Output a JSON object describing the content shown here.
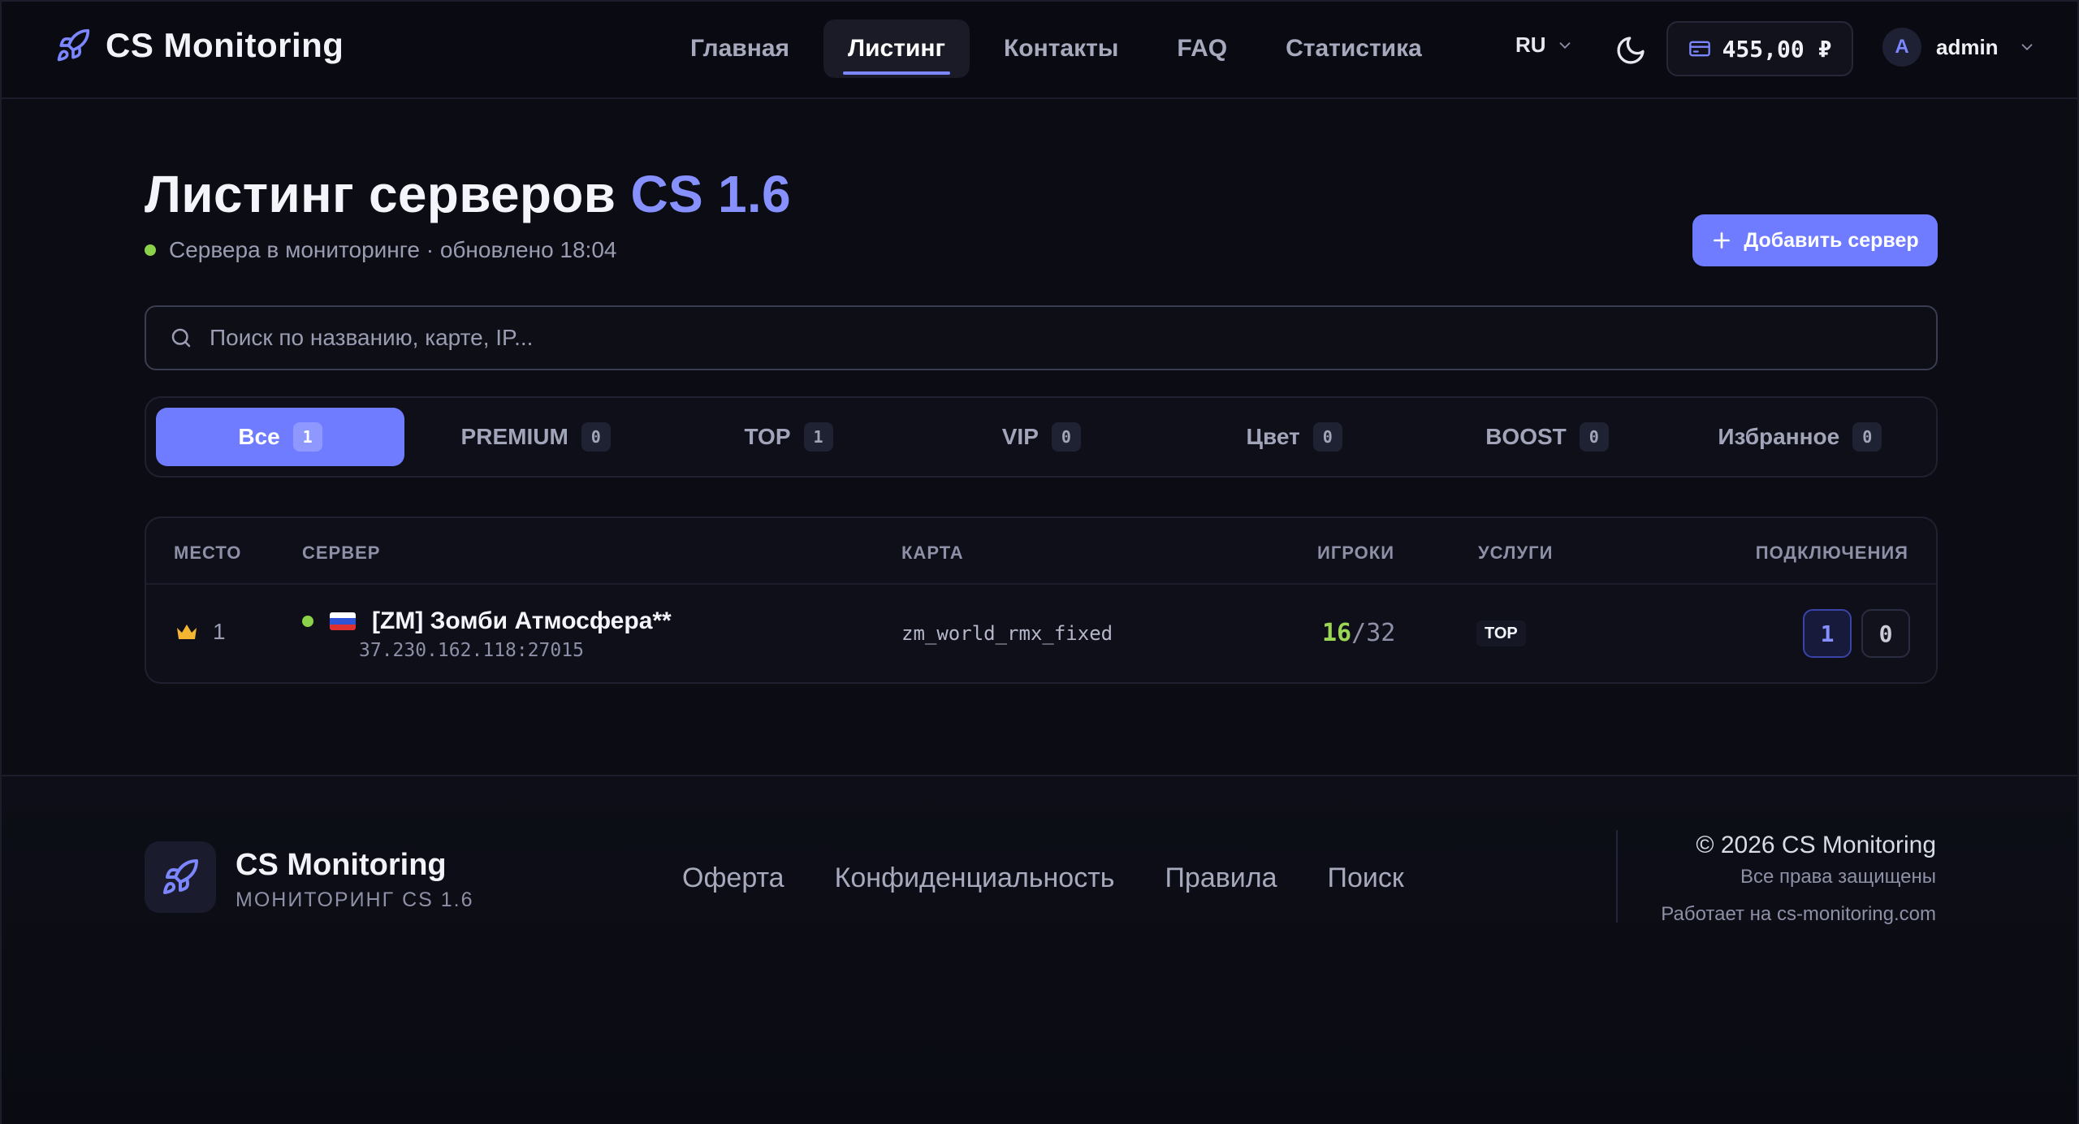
{
  "header": {
    "brand": "CS Monitoring",
    "nav": [
      {
        "label": "Главная",
        "active": false
      },
      {
        "label": "Листинг",
        "active": true
      },
      {
        "label": "Контакты",
        "active": false
      },
      {
        "label": "FAQ",
        "active": false
      },
      {
        "label": "Статистика",
        "active": false
      }
    ],
    "lang": "RU",
    "balance": "455,00 ₽",
    "user": {
      "initial": "A",
      "name": "admin"
    }
  },
  "main": {
    "title": "Листинг серверов",
    "title_accent": "CS 1.6",
    "subtitle": "Сервера в мониторинге · обновлено 18:04",
    "add_button": "Добавить сервер",
    "search_placeholder": "Поиск по названию, карте, IP...",
    "filters": [
      {
        "label": "Все",
        "count": "1",
        "active": true
      },
      {
        "label": "PREMIUM",
        "count": "0",
        "active": false
      },
      {
        "label": "TOP",
        "count": "1",
        "active": false
      },
      {
        "label": "VIP",
        "count": "0",
        "active": false
      },
      {
        "label": "Цвет",
        "count": "0",
        "active": false
      },
      {
        "label": "BOOST",
        "count": "0",
        "active": false
      },
      {
        "label": "Избранное",
        "count": "0",
        "active": false
      }
    ],
    "table": {
      "columns": [
        "МЕСТО",
        "СЕРВЕР",
        "КАРТА",
        "ИГРОКИ",
        "УСЛУГИ",
        "ПОДКЛЮЧЕНИЯ"
      ],
      "rows": [
        {
          "place": "1",
          "name": "[ZM] Зомби Атмосфера**",
          "ip": "37.230.162.118:27015",
          "map": "zm_world_rmx_fixed",
          "players_current": "16",
          "players_sep": "/",
          "players_max": "32",
          "service": "TOP",
          "connect_primary": "1",
          "connect_secondary": "0"
        }
      ]
    }
  },
  "footer": {
    "brand": "CS Monitoring",
    "tagline": "МОНИТОРИНГ CS 1.6",
    "links": [
      "Оферта",
      "Конфиденциальность",
      "Правила",
      "Поиск"
    ],
    "copyright": "© 2026 CS Monitoring",
    "rights": "Все права защищены",
    "powered": "Работает на cs-monitoring.com"
  },
  "colors": {
    "accent": "#6f7cff",
    "online": "#8bd14a",
    "background": "#0b0c14"
  },
  "icons": [
    "rocket-icon",
    "chevron-down-icon",
    "moon-icon",
    "wallet-icon",
    "plus-icon",
    "search-icon",
    "crown-icon",
    "flag-ru-icon"
  ]
}
